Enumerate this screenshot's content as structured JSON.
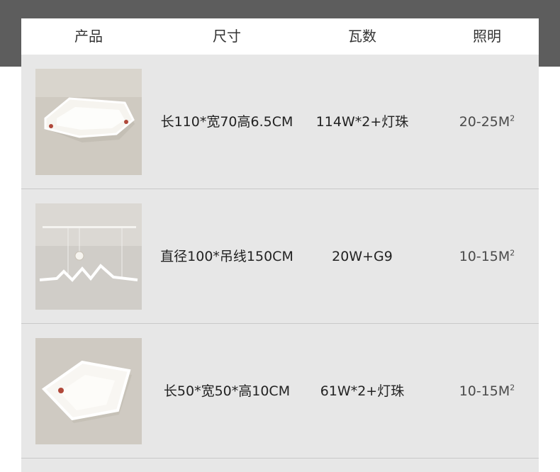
{
  "header": {
    "product": "产品",
    "size": "尺寸",
    "wattage": "瓦数",
    "lighting": "照明"
  },
  "rows": [
    {
      "image": "rectangular-ceiling-lamp",
      "size": "长110*宽70高6.5CM",
      "wattage": "114W*2+灯珠",
      "area": "20-25M",
      "area_sup": "2"
    },
    {
      "image": "wave-pendant-lamp",
      "size": "直径100*吊线150CM",
      "wattage": "20W+G9",
      "area": "10-15M",
      "area_sup": "2"
    },
    {
      "image": "square-ceiling-lamp",
      "size": "长50*宽50*高10CM",
      "wattage": "61W*2+灯珠",
      "area": "10-15M",
      "area_sup": "2"
    }
  ]
}
